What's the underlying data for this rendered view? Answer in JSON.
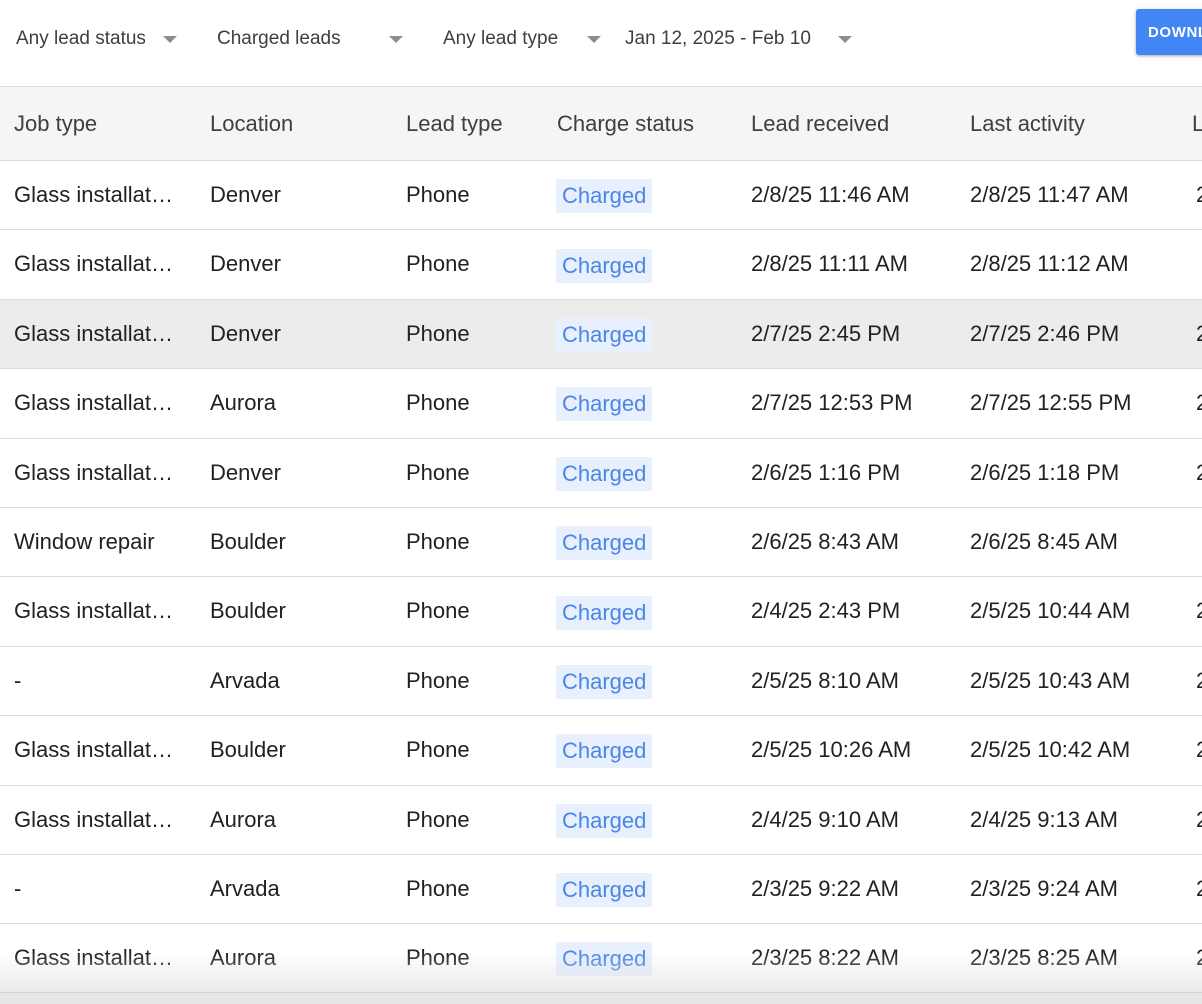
{
  "filters": {
    "lead_status": "Any lead status",
    "charge_filter": "Charged leads",
    "lead_type": "Any lead type",
    "date_range": "Jan 12, 2025 - Feb 10"
  },
  "toolbar": {
    "download_label": "DOWNLOAD"
  },
  "table": {
    "columns": [
      "Job type",
      "Location",
      "Lead type",
      "Charge status",
      "Lead received",
      "Last activity",
      "L"
    ],
    "rows": [
      {
        "job_type": "Glass installation",
        "location": "Denver",
        "lead_type": "Phone",
        "charge_status": "Charged",
        "lead_received": "2/8/25 11:46 AM",
        "last_activity": "2/8/25 11:47 AM",
        "extra": "2"
      },
      {
        "job_type": "Glass installation",
        "location": "Denver",
        "lead_type": "Phone",
        "charge_status": "Charged",
        "lead_received": "2/8/25 11:11 AM",
        "last_activity": "2/8/25 11:12 AM",
        "extra": ""
      },
      {
        "job_type": "Glass installation",
        "location": "Denver",
        "lead_type": "Phone",
        "charge_status": "Charged",
        "lead_received": "2/7/25 2:45 PM",
        "last_activity": "2/7/25 2:46 PM",
        "extra": "2"
      },
      {
        "job_type": "Glass installation",
        "location": "Aurora",
        "lead_type": "Phone",
        "charge_status": "Charged",
        "lead_received": "2/7/25 12:53 PM",
        "last_activity": "2/7/25 12:55 PM",
        "extra": "2"
      },
      {
        "job_type": "Glass installation",
        "location": "Denver",
        "lead_type": "Phone",
        "charge_status": "Charged",
        "lead_received": "2/6/25 1:16 PM",
        "last_activity": "2/6/25 1:18 PM",
        "extra": "2"
      },
      {
        "job_type": "Window repair",
        "location": "Boulder",
        "lead_type": "Phone",
        "charge_status": "Charged",
        "lead_received": "2/6/25 8:43 AM",
        "last_activity": "2/6/25 8:45 AM",
        "extra": ""
      },
      {
        "job_type": "Glass installation",
        "location": "Boulder",
        "lead_type": "Phone",
        "charge_status": "Charged",
        "lead_received": "2/4/25 2:43 PM",
        "last_activity": "2/5/25 10:44 AM",
        "extra": "2"
      },
      {
        "job_type": "-",
        "location": "Arvada",
        "lead_type": "Phone",
        "charge_status": "Charged",
        "lead_received": "2/5/25 8:10 AM",
        "last_activity": "2/5/25 10:43 AM",
        "extra": "2"
      },
      {
        "job_type": "Glass installation",
        "location": "Boulder",
        "lead_type": "Phone",
        "charge_status": "Charged",
        "lead_received": "2/5/25 10:26 AM",
        "last_activity": "2/5/25 10:42 AM",
        "extra": "2"
      },
      {
        "job_type": "Glass installation",
        "location": "Aurora",
        "lead_type": "Phone",
        "charge_status": "Charged",
        "lead_received": "2/4/25 9:10 AM",
        "last_activity": "2/4/25 9:13 AM",
        "extra": "2"
      },
      {
        "job_type": "-",
        "location": "Arvada",
        "lead_type": "Phone",
        "charge_status": "Charged",
        "lead_received": "2/3/25 9:22 AM",
        "last_activity": "2/3/25 9:24 AM",
        "extra": "2"
      },
      {
        "job_type": "Glass installation",
        "location": "Aurora",
        "lead_type": "Phone",
        "charge_status": "Charged",
        "lead_received": "2/3/25 8:22 AM",
        "last_activity": "2/3/25 8:25 AM",
        "extra": "2"
      }
    ]
  },
  "colors": {
    "accent": "#4285f4",
    "chip_bg": "#e8f0fe",
    "chip_text": "#4a86e8",
    "header_bg": "#f5f5f5",
    "hover_row": "#ececec"
  }
}
